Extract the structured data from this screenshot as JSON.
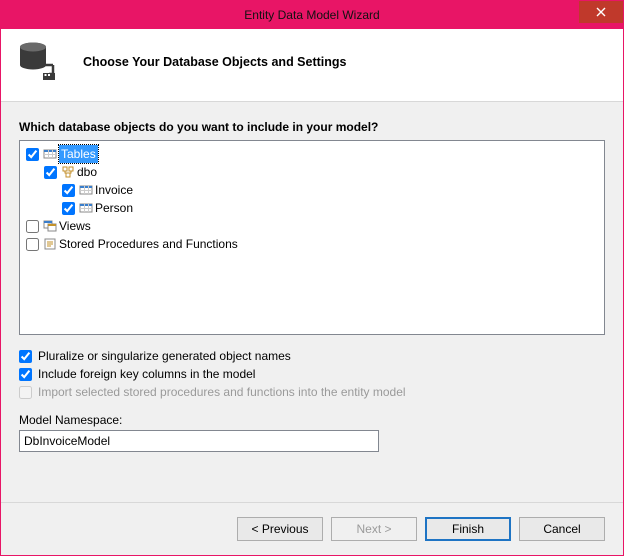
{
  "window": {
    "title": "Entity Data Model Wizard"
  },
  "header": {
    "heading": "Choose Your Database Objects and Settings"
  },
  "prompt": "Which database objects do you want to include in your model?",
  "tree": {
    "tables": {
      "label": "Tables",
      "checked": true,
      "selected": true
    },
    "dbo": {
      "label": "dbo",
      "checked": true
    },
    "invoice": {
      "label": "Invoice",
      "checked": true
    },
    "person": {
      "label": "Person",
      "checked": true
    },
    "views": {
      "label": "Views",
      "checked": false
    },
    "sprocs": {
      "label": "Stored Procedures and Functions",
      "checked": false
    }
  },
  "options": {
    "pluralize": {
      "label": "Pluralize or singularize generated object names",
      "checked": true
    },
    "fk": {
      "label": "Include foreign key columns in the model",
      "checked": true
    },
    "importsp": {
      "label": "Import selected stored procedures and functions into the entity model",
      "checked": false,
      "disabled": true
    }
  },
  "namespace": {
    "label": "Model Namespace:",
    "value": "DbInvoiceModel"
  },
  "buttons": {
    "previous": "< Previous",
    "next": "Next >",
    "finish": "Finish",
    "cancel": "Cancel"
  }
}
